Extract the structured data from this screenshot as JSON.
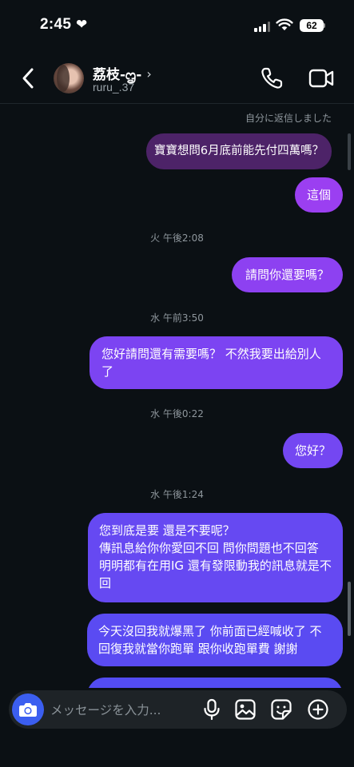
{
  "status": {
    "time": "2:45",
    "battery": "62"
  },
  "header": {
    "name": "荔枝-ᦗ-",
    "handle": "ruru_.37"
  },
  "chat": {
    "reply_note": "自分に返信しました",
    "quoted_text": "寶寶想問6月底前能先付四萬嗎？",
    "messages": [
      {
        "type": "bubble",
        "text": "這個"
      },
      {
        "type": "timestamp",
        "text": "火 午後2:08"
      },
      {
        "type": "bubble",
        "text": "請問你還要嗎？"
      },
      {
        "type": "timestamp",
        "text": "水 午前3:50"
      },
      {
        "type": "bubble",
        "text": "您好請問還有需要嗎？ 不然我要出給別人了"
      },
      {
        "type": "timestamp",
        "text": "水 午後0:22"
      },
      {
        "type": "bubble",
        "text": "您好？"
      },
      {
        "type": "timestamp",
        "text": "水 午後1:24"
      },
      {
        "type": "bubble",
        "text": "您到底是要 還是不要呢？\n傳訊息給你你愛回不回 問你問題也不回答 明明都有在用IG 還有發限動我的訊息就是不回"
      },
      {
        "type": "bubble",
        "text": "今天沒回我就爆黑了 你前面已經喊收了 不回復我就當你跑單 跟你收跑單費 謝謝"
      }
    ]
  },
  "composer": {
    "placeholder": "メッセージを入力..."
  },
  "icons": {
    "back": "chevron-left-icon",
    "call": "phone-icon",
    "video": "video-camera-icon",
    "camera": "camera-icon",
    "mic": "microphone-icon",
    "gallery": "image-icon",
    "sticker": "sticker-icon",
    "plus": "plus-icon"
  },
  "colors": {
    "background": "#0b1014",
    "bubble_top": "#a43ef2",
    "bubble_bottom": "#5a4cf2",
    "quote": "#4d2368",
    "accent": "#3b5ef0"
  }
}
